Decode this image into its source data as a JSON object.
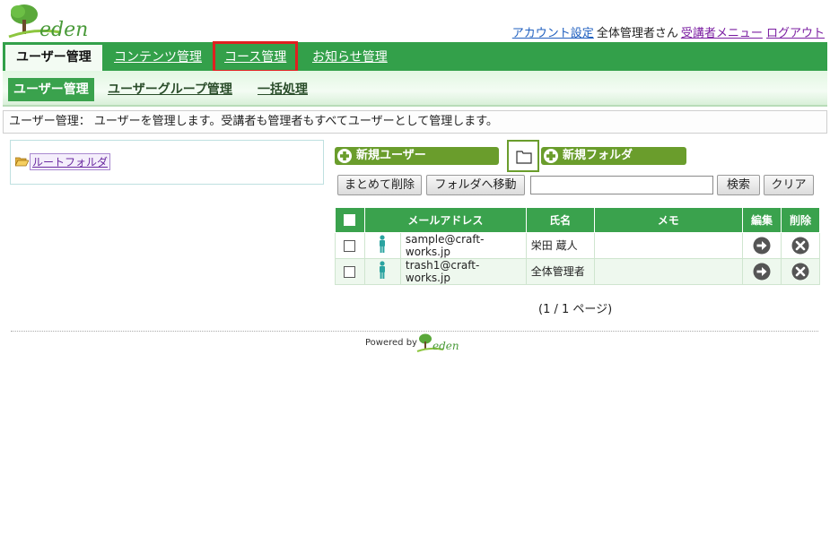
{
  "brand": {
    "logo_text": "eden",
    "powered_by": "Powered by"
  },
  "top_links": {
    "account_settings": "アカウント設定",
    "user_greeting": "全体管理者さん",
    "student_menu": "受講者メニュー",
    "logout": "ログアウト"
  },
  "main_tabs": [
    {
      "label": "ユーザー管理",
      "active": true
    },
    {
      "label": "コンテンツ管理",
      "active": false
    },
    {
      "label": "コース管理",
      "active": false,
      "highlighted": true
    },
    {
      "label": "お知らせ管理",
      "active": false
    }
  ],
  "sub_tabs": [
    {
      "label": "ユーザー管理",
      "active": true
    },
    {
      "label": "ユーザーグループ管理",
      "active": false
    },
    {
      "label": "一括処理",
      "active": false
    }
  ],
  "description": "ユーザー管理： ユーザーを管理します。受講者も管理者もすべてユーザーとして管理します。",
  "folder_tree": {
    "root_label": "ルートフォルダ"
  },
  "actions": {
    "new_user": "新規ユーザー",
    "new_folder": "新規フォルダ",
    "bulk_delete": "まとめて削除",
    "move_to_folder": "フォルダへ移動",
    "search_value": "",
    "search": "検索",
    "clear": "クリア"
  },
  "table": {
    "headers": {
      "email": "メールアドレス",
      "name": "氏名",
      "memo": "メモ",
      "edit": "編集",
      "delete": "削除"
    },
    "rows": [
      {
        "email": "sample@craft-works.jp",
        "name": "栄田 蔵人",
        "memo": ""
      },
      {
        "email": "trash1@craft-works.jp",
        "name": "全体管理者",
        "memo": ""
      }
    ]
  },
  "pagination": "(1 / 1 ページ)",
  "colors": {
    "accent": "#33a04a",
    "highlight": "#e02020",
    "button_green": "#6a9d2c"
  }
}
